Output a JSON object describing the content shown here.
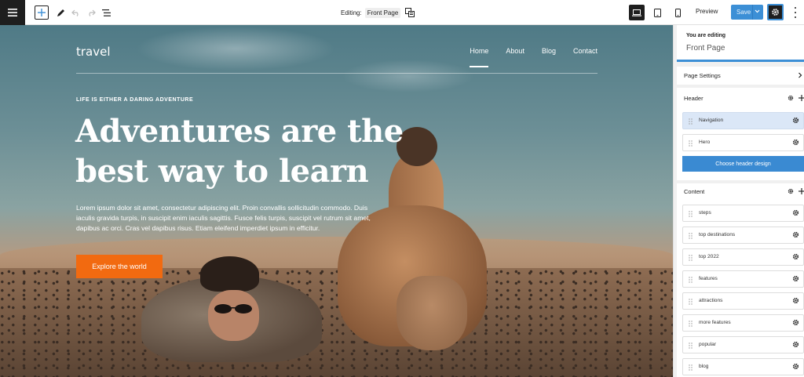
{
  "toolbar": {
    "editing_label": "Editing:",
    "editing_page": "Front Page",
    "preview_label": "Preview",
    "save_label": "Save",
    "icons": [
      "menu-icon",
      "add-icon",
      "pen-icon",
      "undo-icon",
      "redo-icon",
      "list-view-icon",
      "template-icon",
      "desktop-icon",
      "tablet-icon",
      "mobile-icon",
      "chevron-down-icon",
      "gear-icon",
      "kebab-icon"
    ],
    "active_device": "desktop"
  },
  "site": {
    "logo": "travel",
    "nav": [
      "Home",
      "About",
      "Blog",
      "Contact"
    ],
    "active_nav": "Home"
  },
  "hero": {
    "eyebrow": "LIFE IS EITHER A DARING ADVENTURE",
    "headline_line1": "Adventures are the",
    "headline_line2": "best way to learn",
    "body": "Lorem ipsum dolor sit amet, consectetur adipiscing elit. Proin convallis sollicitudin commodo. Duis iaculis gravida turpis, in suscipit enim iaculis sagittis. Fusce felis turpis, suscipit vel rutrum sit amet, dapibus ac orci. Cras vel dapibus risus. Etiam eleifend imperdiet ipsum in efficitur.",
    "cta": "Explore the world",
    "cta_color": "#f26a10"
  },
  "panel": {
    "you_are_editing": "You are editing",
    "page_name": "Front Page",
    "page_settings": "Page Settings",
    "header_title": "Header",
    "header_items": [
      "Navigation",
      "Hero"
    ],
    "selected_item": "Navigation",
    "choose_header": "Choose header design",
    "content_title": "Content",
    "content_items": [
      "steps",
      "top destinations",
      "top 2022",
      "features",
      "attractions",
      "more features",
      "popular",
      "blog"
    ],
    "accent": "#3c8fd6"
  }
}
